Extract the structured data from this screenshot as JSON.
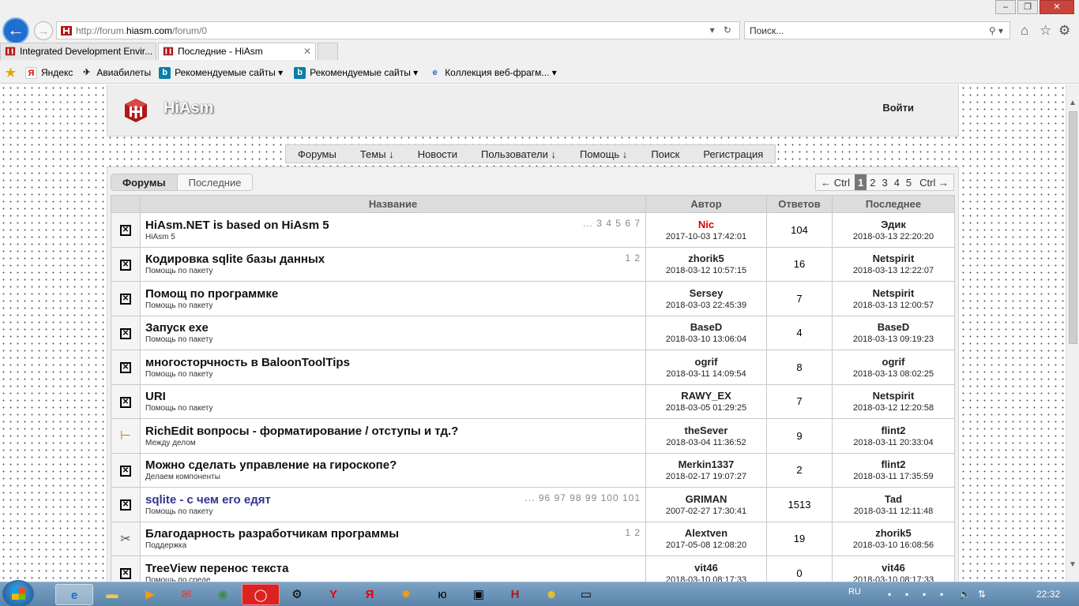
{
  "browser": {
    "url_prefix": "http://forum.",
    "url_host": "hiasm.com",
    "url_suffix": "/forum/0",
    "search_placeholder": "Поиск...",
    "tabs": [
      {
        "label": "Integrated Development Envir..."
      },
      {
        "label": "Последние - HiAsm"
      }
    ],
    "favorites": [
      {
        "label": "Яндекс",
        "icon": "yandex-icon"
      },
      {
        "label": "Авиабилеты",
        "icon": "plane-icon"
      },
      {
        "label": "Рекомендуемые сайты",
        "icon": "bing-icon"
      },
      {
        "label": "Рекомендуемые сайты",
        "icon": "bing-icon"
      },
      {
        "label": "Коллекция веб-фрагм...",
        "icon": "ie-icon"
      }
    ]
  },
  "site": {
    "name": "HiAsm",
    "login": "Войти",
    "nav": [
      "Форумы",
      "Темы ↓",
      "Новости",
      "Пользователи ↓",
      "Помощь ↓",
      "Поиск",
      "Регистрация"
    ]
  },
  "subtabs": {
    "forums": "Форумы",
    "latest": "Последние"
  },
  "pager": {
    "prev": "← Ctrl",
    "pages": [
      "1",
      "2",
      "3",
      "4",
      "5"
    ],
    "current": "1",
    "next": "Ctrl →"
  },
  "table": {
    "headers": {
      "title": "Название",
      "author": "Автор",
      "replies": "Ответов",
      "last": "Последнее"
    },
    "rows": [
      {
        "icon": "closed",
        "title": "HiAsm.NET is based on HiAsm 5",
        "sub": "HiAsm 5",
        "pages": "... 3 4 5 6 7",
        "author": "Nic",
        "author_red": true,
        "date": "2017-10-03 17:42:01",
        "replies": "104",
        "last_user": "Эдик",
        "last_date": "2018-03-13 22:20:20"
      },
      {
        "icon": "closed",
        "title": "Кодировка sqlite базы данных",
        "sub": "Помощь по пакету",
        "pages": "1 2",
        "author": "zhorik5",
        "date": "2018-03-12 10:57:15",
        "replies": "16",
        "last_user": "Netspirit",
        "last_date": "2018-03-13 12:22:07"
      },
      {
        "icon": "closed",
        "title": "Помощ по программке",
        "sub": "Помощь по пакету",
        "pages": "",
        "author": "Sersey",
        "date": "2018-03-03 22:45:39",
        "replies": "7",
        "last_user": "Netspirit",
        "last_date": "2018-03-13 12:00:57"
      },
      {
        "icon": "closed",
        "title": "Запуск exe",
        "sub": "Помощь по пакету",
        "pages": "",
        "author": "BaseD",
        "date": "2018-03-10 13:06:04",
        "replies": "4",
        "last_user": "BaseD",
        "last_date": "2018-03-13 09:19:23"
      },
      {
        "icon": "closed",
        "title": "многосторчность в BaloonToolTips",
        "sub": "Помощь по пакету",
        "pages": "",
        "author": "ogrif",
        "date": "2018-03-11 14:09:54",
        "replies": "8",
        "last_user": "ogrif",
        "last_date": "2018-03-13 08:02:25"
      },
      {
        "icon": "closed",
        "title": "URI",
        "sub": "Помощь по пакету",
        "pages": "",
        "author": "RAWY_EX",
        "date": "2018-03-05 01:29:25",
        "replies": "7",
        "last_user": "Netspirit",
        "last_date": "2018-03-12 12:20:58"
      },
      {
        "icon": "signpost",
        "title": "RichEdit вопросы - форматирование / отступы и тд.?",
        "sub": "Между делом",
        "pages": "",
        "author": "theSever",
        "date": "2018-03-04 11:36:52",
        "replies": "9",
        "last_user": "flint2",
        "last_date": "2018-03-11 20:33:04"
      },
      {
        "icon": "closed",
        "title": "Можно сделать управление на гироскопе?",
        "sub": "Делаем компоненты",
        "pages": "",
        "author": "Merkin1337",
        "date": "2018-02-17 19:07:27",
        "replies": "2",
        "last_user": "flint2",
        "last_date": "2018-03-11 17:35:59"
      },
      {
        "icon": "closed",
        "title": "sqlite - с чем его едят",
        "sub": "Помощь по пакету",
        "pages": "... 96 97 98 99 100 101",
        "link": true,
        "author": "GRIMAN",
        "date": "2007-02-27 17:30:41",
        "replies": "1513",
        "last_user": "Tad",
        "last_date": "2018-03-11 12:11:48"
      },
      {
        "icon": "tools",
        "title": "Благодарность разработчикам программы",
        "sub": "Поддержка",
        "pages": "1 2",
        "author": "Alextven",
        "date": "2017-05-08 12:08:20",
        "replies": "19",
        "last_user": "zhorik5",
        "last_date": "2018-03-10 16:08:56"
      },
      {
        "icon": "closed",
        "title": "TreeView перенос текста",
        "sub": "Помощь по среде",
        "pages": "",
        "author": "vit46",
        "date": "2018-03-10 08:17:33",
        "replies": "0",
        "last_user": "vit46",
        "last_date": "2018-03-10 08:17:33"
      }
    ]
  },
  "taskbar": {
    "lang": "RU",
    "clock": "22:32"
  }
}
